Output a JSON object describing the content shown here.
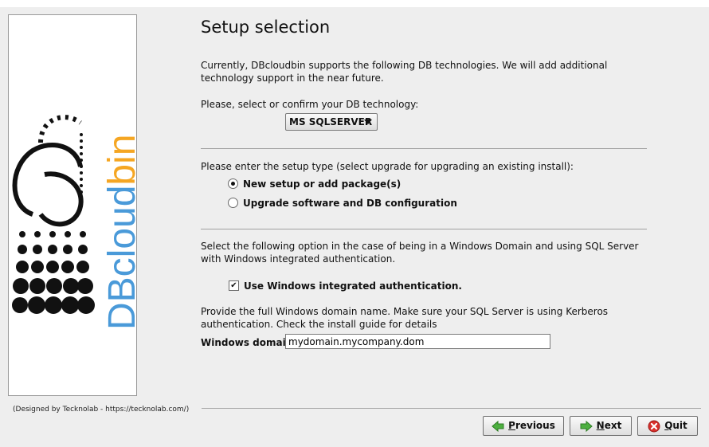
{
  "window": {
    "title": "Setup selection"
  },
  "intro": "Currently, DBcloudbin supports the following DB technologies. We will add additional technology support in the near future.",
  "db_prompt": "Please, select or confirm your DB technology:",
  "db_select": {
    "value": "MS SQLSERVER"
  },
  "setup_prompt": "Please enter the setup type (select upgrade for upgrading an existing install):",
  "setup_options": [
    {
      "label": "New setup or add package(s)",
      "selected": true
    },
    {
      "label": "Upgrade software and DB configuration",
      "selected": false
    }
  ],
  "windows_auth_prompt": "Select the following option in the case of being in a Windows Domain and using SQL Server with Windows integrated authentication.",
  "windows_auth_checkbox": {
    "label": "Use Windows integrated authentication.",
    "checked": true
  },
  "domain_prompt": "Provide the full Windows domain name. Make sure your SQL Server is using Kerberos authentication. Check the install guide for details",
  "domain_field": {
    "label": "Windows domain:",
    "value": "mydomain.mycompany.dom"
  },
  "footer": {
    "credit": "(Designed by Tecknolab - https://tecknolab.com/)"
  },
  "buttons": {
    "previous": "Previous",
    "next": "Next",
    "quit": "Quit"
  },
  "logo": {
    "brand_text": "DBcloudbin",
    "color_db": "#4a9ad9",
    "color_bin": "#f5a623",
    "color_cloud": "#4a9ad9"
  },
  "icons": {
    "previous": "green-arrow-left-icon",
    "next": "green-arrow-right-icon",
    "quit": "red-x-icon"
  }
}
